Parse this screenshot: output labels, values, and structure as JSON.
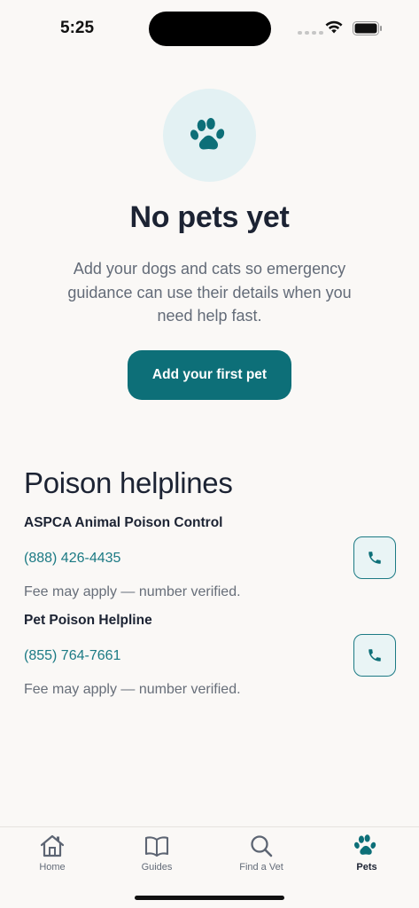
{
  "status_bar": {
    "time": "5:25"
  },
  "empty_state": {
    "title": "No pets yet",
    "description": "Add your dogs and cats so emergency guidance can use their details when you need help fast.",
    "button_label": "Add your first pet",
    "icon": "paw-icon"
  },
  "helplines": {
    "title": "Poison helplines",
    "items": [
      {
        "name": "ASPCA Animal Poison Control",
        "phone": "(888) 426-4435",
        "note": "Fee may apply — number verified."
      },
      {
        "name": "Pet Poison Helpline",
        "phone": "(855) 764-7661",
        "note": "Fee may apply — number verified."
      }
    ]
  },
  "tab_bar": {
    "tabs": [
      {
        "label": "Home",
        "icon": "house-icon"
      },
      {
        "label": "Guides",
        "icon": "book-icon"
      },
      {
        "label": "Find a Vet",
        "icon": "search-icon"
      },
      {
        "label": "Pets",
        "icon": "paw-icon",
        "active": true
      }
    ]
  },
  "colors": {
    "accent": "#0d6f78",
    "link": "#1b7a84",
    "background": "#faf8f6",
    "paw_circle": "#e3f1f3"
  }
}
